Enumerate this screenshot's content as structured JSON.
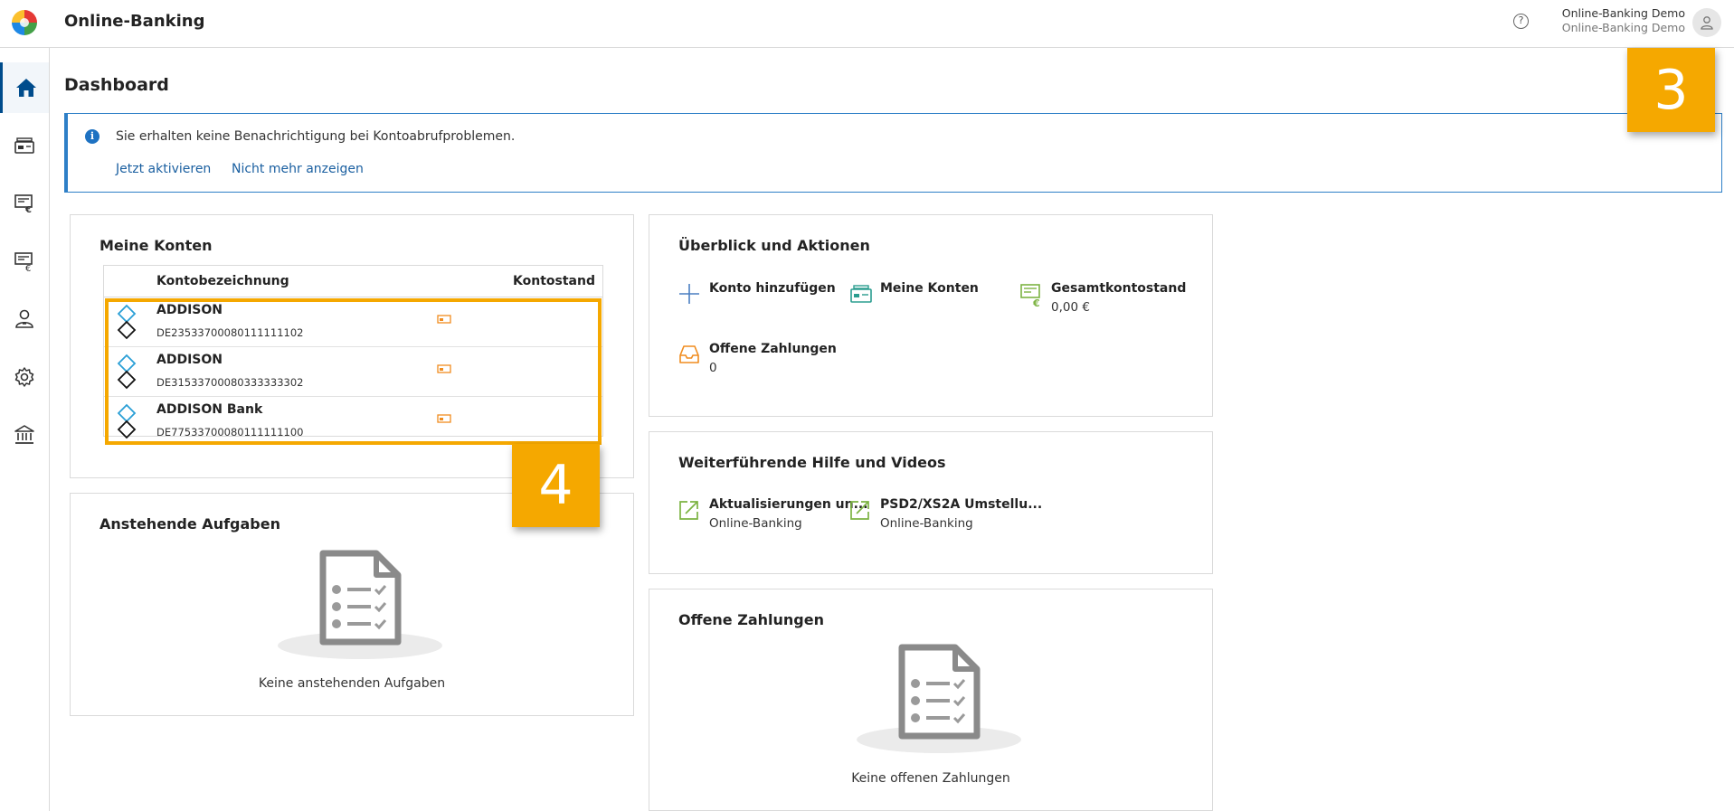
{
  "header": {
    "app_title": "Online-Banking",
    "user_name": "Online-Banking Demo",
    "user_sub": "Online-Banking Demo"
  },
  "sidebar": {
    "items": [
      {
        "icon": "home-icon",
        "active": true
      },
      {
        "icon": "accounts-icon"
      },
      {
        "icon": "payments-icon"
      },
      {
        "icon": "transfers-icon"
      },
      {
        "icon": "contacts-icon"
      },
      {
        "icon": "settings-icon"
      },
      {
        "icon": "bank-icon"
      }
    ]
  },
  "page": {
    "title": "Dashboard"
  },
  "notice": {
    "message": "Sie erhalten keine Benachrichtigung bei Kontoabrufproblemen.",
    "activate_link": "Jetzt aktivieren",
    "dismiss_link": "Nicht mehr anzeigen"
  },
  "accounts": {
    "title": "Meine Konten",
    "col_name": "Kontobezeichnung",
    "col_balance": "Kontostand",
    "rows": [
      {
        "name": "ADDISON",
        "iban": "DE23533700080111111102"
      },
      {
        "name": "ADDISON",
        "iban": "DE31533700080333333302"
      },
      {
        "name": "ADDISON Bank",
        "iban": "DE77533700080111111100"
      }
    ]
  },
  "tasks": {
    "title": "Anstehende Aufgaben",
    "empty_text": "Keine anstehenden Aufgaben"
  },
  "overview": {
    "title": "Überblick und Aktionen",
    "add_account": "Konto hinzufügen",
    "my_accounts": "Meine Konten",
    "total_balance_label": "Gesamtkontostand",
    "total_balance_value": "0,00 €",
    "open_payments_label": "Offene Zahlungen",
    "open_payments_value": "0"
  },
  "help": {
    "title": "Weiterführende Hilfe und Videos",
    "links": [
      {
        "title": "Aktualisierungen un...",
        "sub": "Online-Banking"
      },
      {
        "title": "PSD2/XS2A Umstellu...",
        "sub": "Online-Banking"
      }
    ]
  },
  "open_payments": {
    "title": "Offene Zahlungen",
    "empty_text": "Keine offenen Zahlungen"
  },
  "badges": {
    "top": "3",
    "accounts": "4"
  },
  "colors": {
    "accent": "#004c8c",
    "highlight": "#f5a800",
    "green": "#7cb342",
    "orange": "#f08c1e",
    "teal": "#2a9d8f"
  }
}
